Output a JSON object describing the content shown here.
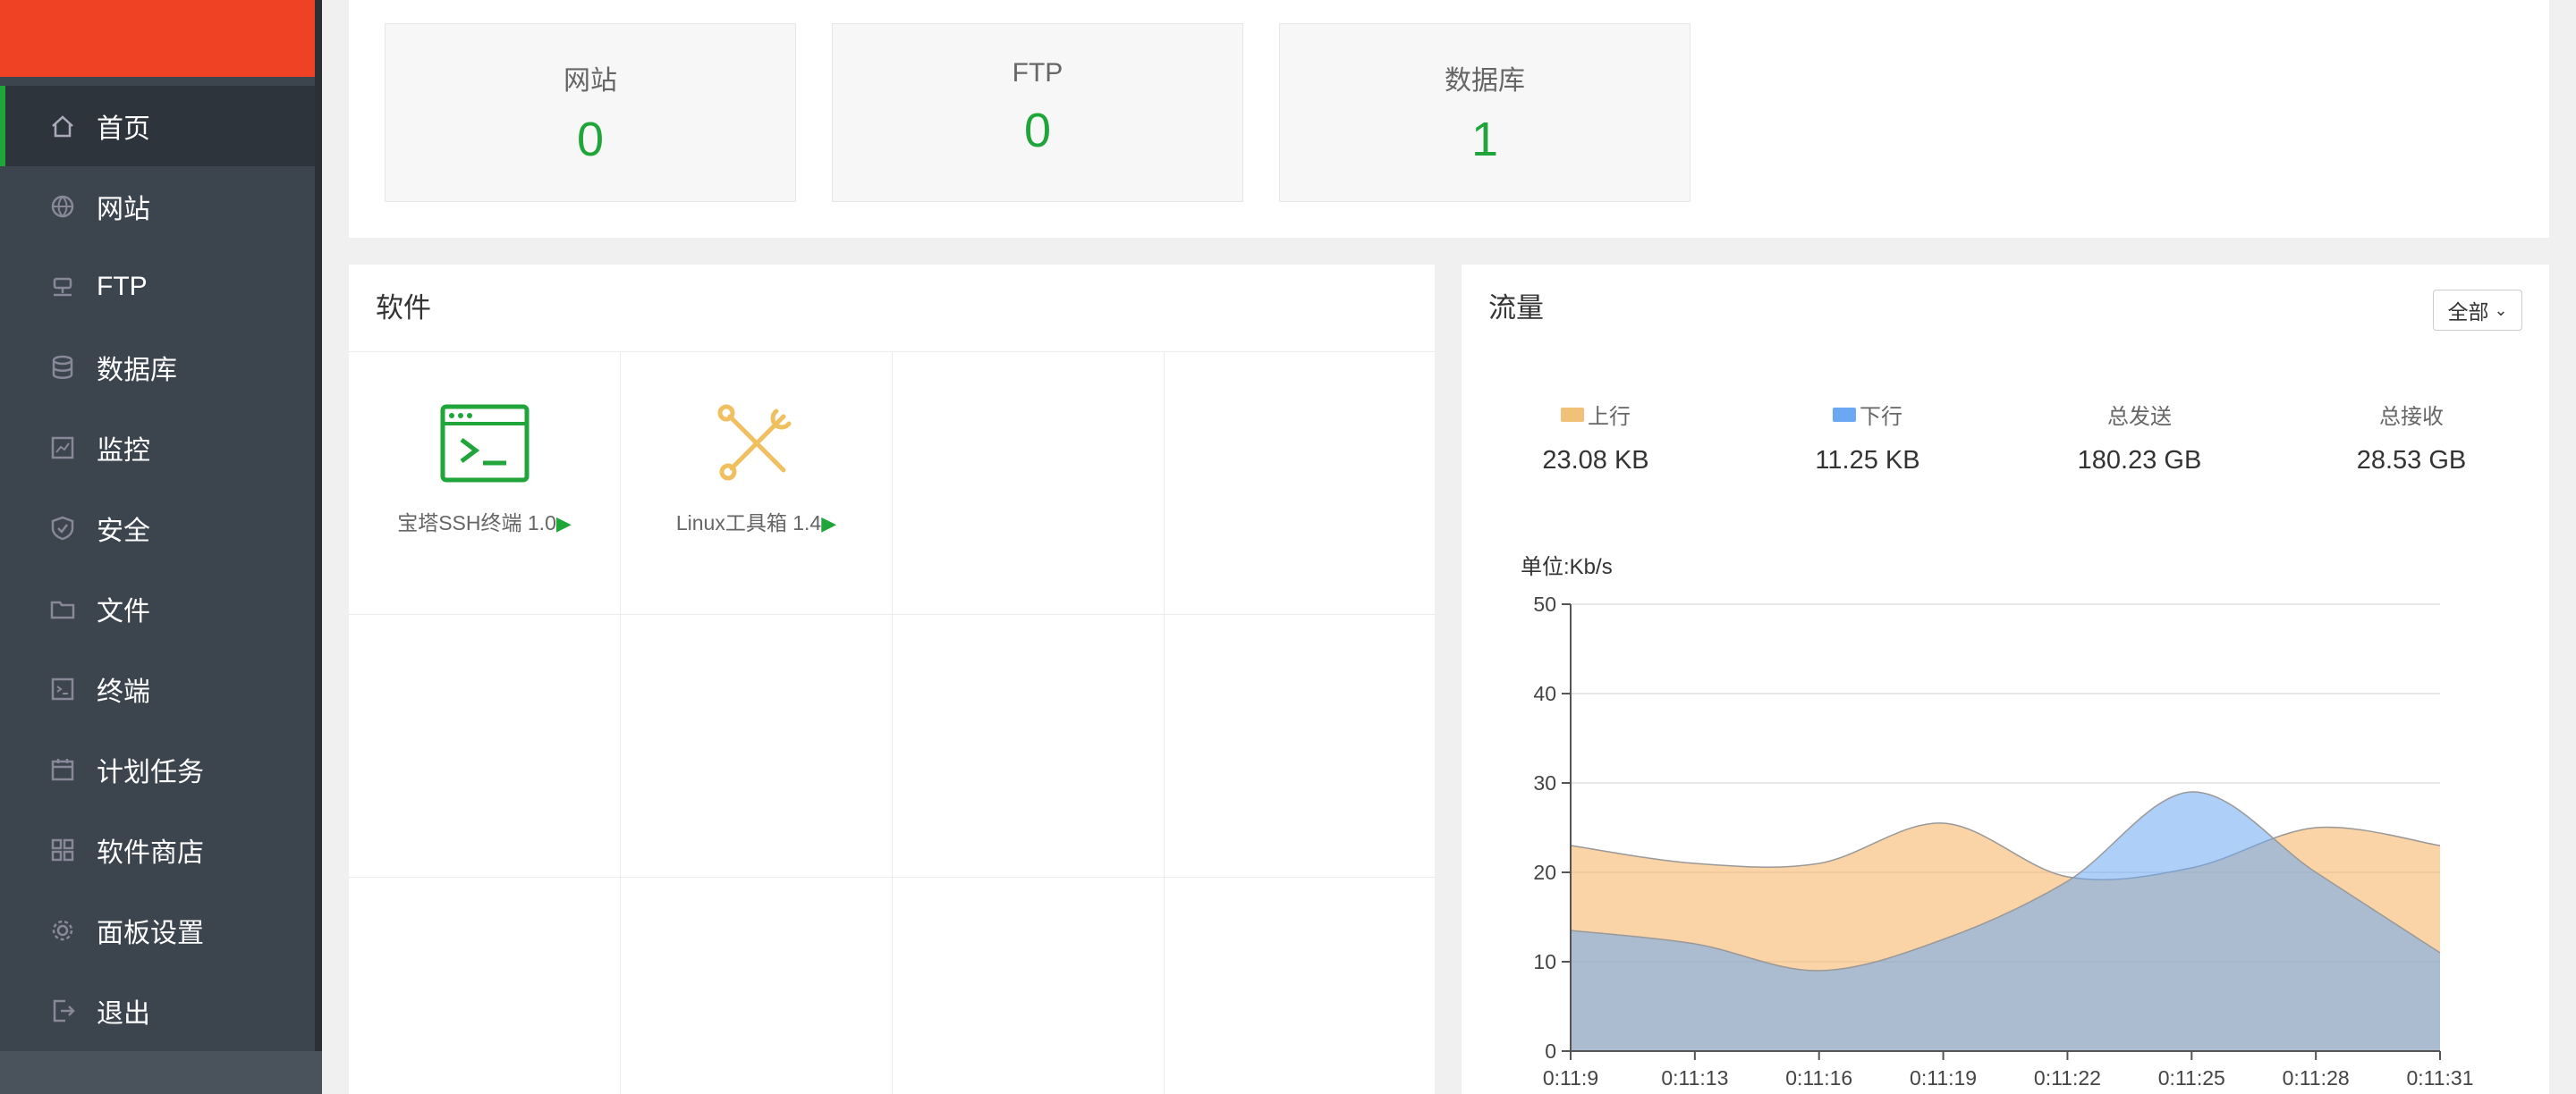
{
  "sidebar": {
    "items": [
      {
        "label": "首页",
        "icon": "home-icon",
        "active": true
      },
      {
        "label": "网站",
        "icon": "globe-icon"
      },
      {
        "label": "FTP",
        "icon": "ftp-icon"
      },
      {
        "label": "数据库",
        "icon": "database-icon"
      },
      {
        "label": "监控",
        "icon": "monitor-icon"
      },
      {
        "label": "安全",
        "icon": "shield-icon"
      },
      {
        "label": "文件",
        "icon": "folder-icon"
      },
      {
        "label": "终端",
        "icon": "terminal-icon"
      },
      {
        "label": "计划任务",
        "icon": "calendar-icon"
      },
      {
        "label": "软件商店",
        "icon": "apps-grid-icon"
      },
      {
        "label": "面板设置",
        "icon": "gear-icon"
      },
      {
        "label": "退出",
        "icon": "logout-icon"
      }
    ]
  },
  "stats": [
    {
      "label": "网站",
      "value": "0"
    },
    {
      "label": "FTP",
      "value": "0"
    },
    {
      "label": "数据库",
      "value": "1"
    }
  ],
  "software": {
    "title": "软件",
    "items": [
      {
        "name": "宝塔SSH终端 1.0",
        "icon": "terminal-app-icon"
      },
      {
        "name": "Linux工具箱 1.4",
        "icon": "tools-icon"
      }
    ],
    "play_glyph": "▶"
  },
  "traffic": {
    "title": "流量",
    "filter": "全部",
    "stats": [
      {
        "label": "上行",
        "value": "23.08 KB",
        "color": "#f0c277"
      },
      {
        "label": "下行",
        "value": "11.25 KB",
        "color": "#6aa8f2"
      },
      {
        "label": "总发送",
        "value": "180.23 GB"
      },
      {
        "label": "总接收",
        "value": "28.53 GB"
      }
    ]
  },
  "chart_data": {
    "type": "area",
    "ylabel": "单位:Kb/s",
    "ylim": [
      0,
      50
    ],
    "yticks": [
      0,
      10,
      20,
      30,
      40,
      50
    ],
    "categories": [
      "0:11:9",
      "0:11:13",
      "0:11:16",
      "0:11:19",
      "0:11:22",
      "0:11:25",
      "0:11:28",
      "0:11:31"
    ],
    "series": [
      {
        "name": "上行",
        "color": "#f6b56b",
        "values": [
          23,
          21,
          21,
          25.5,
          19.5,
          20.5,
          25,
          23
        ]
      },
      {
        "name": "下行",
        "color": "#7eb6f2",
        "values": [
          13.5,
          12,
          9,
          12.5,
          19,
          29,
          20,
          11
        ]
      }
    ],
    "grid": true
  }
}
